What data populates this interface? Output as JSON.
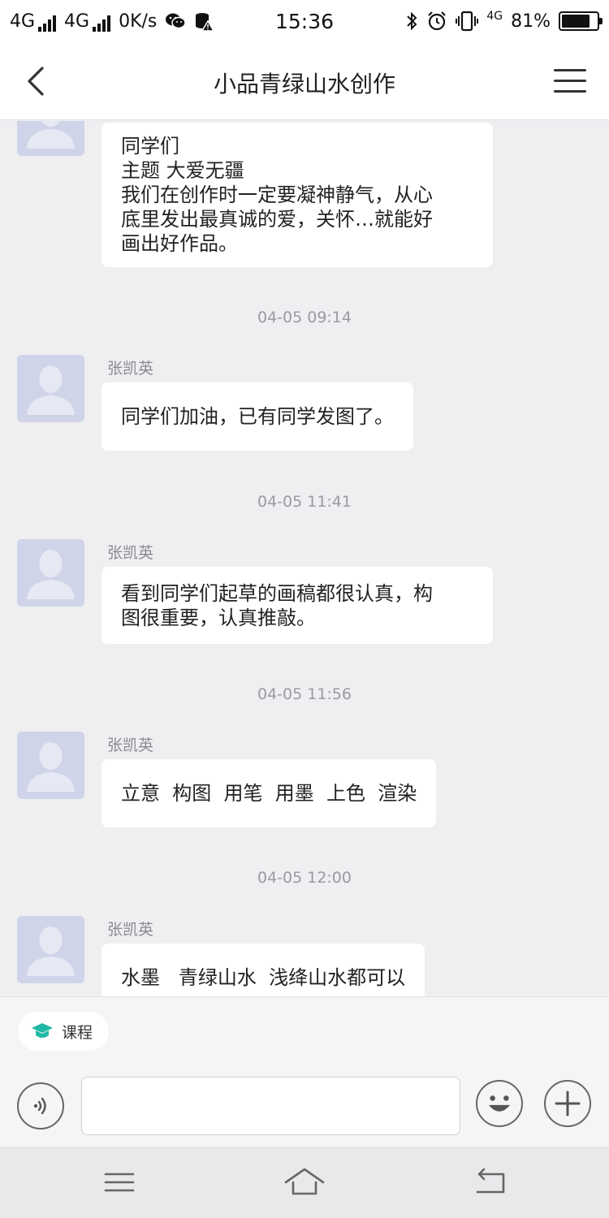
{
  "status_bar": {
    "net1": "4G",
    "net2": "4G",
    "speed": "0K/s",
    "time": "15:36",
    "net3": "4G",
    "battery_text": "81%",
    "battery_level": 0.81
  },
  "nav": {
    "title": "小品青绿山水创作"
  },
  "messages": [
    {
      "sender": "",
      "text": "同学们\n主题 大爱无疆\n我们在创作时一定要凝神静气，从心\n底里发出最真诚的爱，关怀…就能好\n画出好作品。"
    },
    {
      "timestamp": "04-05 09:14",
      "sender": "张凯英",
      "text": "同学们加油，已有同学发图了。"
    },
    {
      "timestamp": "04-05 11:41",
      "sender": "张凯英",
      "text": "看到同学们起草的画稿都很认真，构\n图很重要，认真推敲。"
    },
    {
      "timestamp": "04-05 11:56",
      "sender": "张凯英",
      "text": "立意  构图  用笔  用墨  上色  渲染"
    },
    {
      "timestamp": "04-05 12:00",
      "sender": "张凯英",
      "text": "水墨   青绿山水  浅绛山水都可以"
    }
  ],
  "input": {
    "course_label": "课程",
    "placeholder": "",
    "accent_color": "#1fb8a6"
  }
}
